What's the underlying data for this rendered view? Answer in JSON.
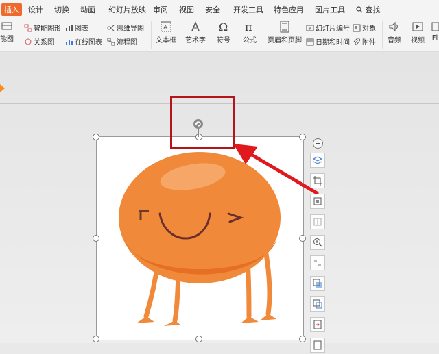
{
  "tabs": [
    "插入",
    "设计",
    "切换",
    "动画",
    "幻灯片放映",
    "审阅",
    "视图",
    "安全",
    "开发工具",
    "特色应用",
    "图片工具",
    "查找"
  ],
  "ribbon": {
    "partial_left_top": "能图",
    "smart_graphic": "智能图形",
    "chart": "图表",
    "mind_map": "思维导图",
    "relation_graph": "关系图",
    "online_chart": "在线图表",
    "flowchart": "流程图",
    "textbox": "文本框",
    "art_text": "艺术字",
    "symbol": "符号",
    "formula": "公式",
    "header_footer": "页眉和页脚",
    "slide_number": "幻灯片编号",
    "object": "对象",
    "date_time": "日期和时间",
    "attachment": "附件",
    "audio": "音频",
    "video": "视频",
    "partial_right": "Fl"
  },
  "colors": {
    "accent": "#ee6a2c",
    "highlight": "#b4141a",
    "arrow": "#e0191e",
    "character": "#f08a3a"
  }
}
